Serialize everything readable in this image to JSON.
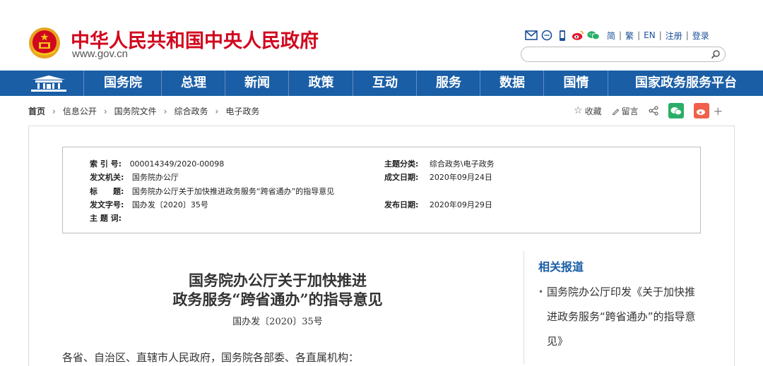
{
  "header": {
    "site_name": "中华人民共和国中央人民政府",
    "domain": "www.gov.cn",
    "tools": [
      "mail-icon",
      "chat-bubble-icon",
      "mobile-icon",
      "weibo-icon",
      "wechat-icon"
    ],
    "lang_links": [
      "简",
      "繁",
      "EN",
      "注册",
      "登录"
    ],
    "search_placeholder": ""
  },
  "nav": {
    "items": [
      "国务院",
      "总理",
      "新闻",
      "政策",
      "互动",
      "服务",
      "数据",
      "国情",
      "国家政务服务平台"
    ]
  },
  "breadcrumb": {
    "items": [
      "首页",
      "信息公开",
      "国务院文件",
      "综合政务",
      "电子政务"
    ]
  },
  "share": {
    "favorite": "收藏",
    "comment": "留言"
  },
  "meta": {
    "index_label": "索 引 号:",
    "index_value": "000014349/2020-00098",
    "topic_label": "主题分类:",
    "topic_value": "综合政务\\电子政务",
    "issuer_label": "发文机关:",
    "issuer_value": "国务院办公厅",
    "written_label": "成文日期:",
    "written_value": "2020年09月24日",
    "title_label": "标　　题:",
    "title_value": "国务院办公厅关于加快推进政务服务“跨省通办”的指导意见",
    "docno_label": "发文字号:",
    "docno_value": "国办发〔2020〕35号",
    "published_label": "发布日期:",
    "published_value": "2020年09月29日",
    "keywords_label": "主 题 词:",
    "keywords_value": ""
  },
  "document": {
    "title_line1": "国务院办公厅关于加快推进",
    "title_line2": "政务服务“跨省通办”的指导意见",
    "number": "国办发〔2020〕35号",
    "body_start": "各省、自治区、直辖市人民政府，国务院各部委、各直属机构："
  },
  "related": {
    "heading": "相关报道",
    "items": [
      "国务院办公厅印发《关于加快推进政务服务“跨省通办”的指导意见》"
    ]
  },
  "colors": {
    "brand_red": "#d0071e",
    "nav_blue": "#1a5ea6",
    "link_blue": "#1a4f99"
  }
}
